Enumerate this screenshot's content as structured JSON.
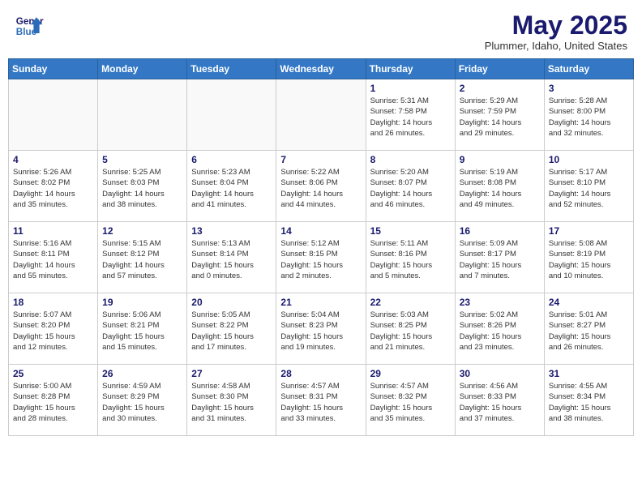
{
  "header": {
    "logo_line1": "General",
    "logo_line2": "Blue",
    "month": "May 2025",
    "location": "Plummer, Idaho, United States"
  },
  "weekdays": [
    "Sunday",
    "Monday",
    "Tuesday",
    "Wednesday",
    "Thursday",
    "Friday",
    "Saturday"
  ],
  "weeks": [
    [
      {
        "day": "",
        "detail": ""
      },
      {
        "day": "",
        "detail": ""
      },
      {
        "day": "",
        "detail": ""
      },
      {
        "day": "",
        "detail": ""
      },
      {
        "day": "1",
        "detail": "Sunrise: 5:31 AM\nSunset: 7:58 PM\nDaylight: 14 hours\nand 26 minutes."
      },
      {
        "day": "2",
        "detail": "Sunrise: 5:29 AM\nSunset: 7:59 PM\nDaylight: 14 hours\nand 29 minutes."
      },
      {
        "day": "3",
        "detail": "Sunrise: 5:28 AM\nSunset: 8:00 PM\nDaylight: 14 hours\nand 32 minutes."
      }
    ],
    [
      {
        "day": "4",
        "detail": "Sunrise: 5:26 AM\nSunset: 8:02 PM\nDaylight: 14 hours\nand 35 minutes."
      },
      {
        "day": "5",
        "detail": "Sunrise: 5:25 AM\nSunset: 8:03 PM\nDaylight: 14 hours\nand 38 minutes."
      },
      {
        "day": "6",
        "detail": "Sunrise: 5:23 AM\nSunset: 8:04 PM\nDaylight: 14 hours\nand 41 minutes."
      },
      {
        "day": "7",
        "detail": "Sunrise: 5:22 AM\nSunset: 8:06 PM\nDaylight: 14 hours\nand 44 minutes."
      },
      {
        "day": "8",
        "detail": "Sunrise: 5:20 AM\nSunset: 8:07 PM\nDaylight: 14 hours\nand 46 minutes."
      },
      {
        "day": "9",
        "detail": "Sunrise: 5:19 AM\nSunset: 8:08 PM\nDaylight: 14 hours\nand 49 minutes."
      },
      {
        "day": "10",
        "detail": "Sunrise: 5:17 AM\nSunset: 8:10 PM\nDaylight: 14 hours\nand 52 minutes."
      }
    ],
    [
      {
        "day": "11",
        "detail": "Sunrise: 5:16 AM\nSunset: 8:11 PM\nDaylight: 14 hours\nand 55 minutes."
      },
      {
        "day": "12",
        "detail": "Sunrise: 5:15 AM\nSunset: 8:12 PM\nDaylight: 14 hours\nand 57 minutes."
      },
      {
        "day": "13",
        "detail": "Sunrise: 5:13 AM\nSunset: 8:14 PM\nDaylight: 15 hours\nand 0 minutes."
      },
      {
        "day": "14",
        "detail": "Sunrise: 5:12 AM\nSunset: 8:15 PM\nDaylight: 15 hours\nand 2 minutes."
      },
      {
        "day": "15",
        "detail": "Sunrise: 5:11 AM\nSunset: 8:16 PM\nDaylight: 15 hours\nand 5 minutes."
      },
      {
        "day": "16",
        "detail": "Sunrise: 5:09 AM\nSunset: 8:17 PM\nDaylight: 15 hours\nand 7 minutes."
      },
      {
        "day": "17",
        "detail": "Sunrise: 5:08 AM\nSunset: 8:19 PM\nDaylight: 15 hours\nand 10 minutes."
      }
    ],
    [
      {
        "day": "18",
        "detail": "Sunrise: 5:07 AM\nSunset: 8:20 PM\nDaylight: 15 hours\nand 12 minutes."
      },
      {
        "day": "19",
        "detail": "Sunrise: 5:06 AM\nSunset: 8:21 PM\nDaylight: 15 hours\nand 15 minutes."
      },
      {
        "day": "20",
        "detail": "Sunrise: 5:05 AM\nSunset: 8:22 PM\nDaylight: 15 hours\nand 17 minutes."
      },
      {
        "day": "21",
        "detail": "Sunrise: 5:04 AM\nSunset: 8:23 PM\nDaylight: 15 hours\nand 19 minutes."
      },
      {
        "day": "22",
        "detail": "Sunrise: 5:03 AM\nSunset: 8:25 PM\nDaylight: 15 hours\nand 21 minutes."
      },
      {
        "day": "23",
        "detail": "Sunrise: 5:02 AM\nSunset: 8:26 PM\nDaylight: 15 hours\nand 23 minutes."
      },
      {
        "day": "24",
        "detail": "Sunrise: 5:01 AM\nSunset: 8:27 PM\nDaylight: 15 hours\nand 26 minutes."
      }
    ],
    [
      {
        "day": "25",
        "detail": "Sunrise: 5:00 AM\nSunset: 8:28 PM\nDaylight: 15 hours\nand 28 minutes."
      },
      {
        "day": "26",
        "detail": "Sunrise: 4:59 AM\nSunset: 8:29 PM\nDaylight: 15 hours\nand 30 minutes."
      },
      {
        "day": "27",
        "detail": "Sunrise: 4:58 AM\nSunset: 8:30 PM\nDaylight: 15 hours\nand 31 minutes."
      },
      {
        "day": "28",
        "detail": "Sunrise: 4:57 AM\nSunset: 8:31 PM\nDaylight: 15 hours\nand 33 minutes."
      },
      {
        "day": "29",
        "detail": "Sunrise: 4:57 AM\nSunset: 8:32 PM\nDaylight: 15 hours\nand 35 minutes."
      },
      {
        "day": "30",
        "detail": "Sunrise: 4:56 AM\nSunset: 8:33 PM\nDaylight: 15 hours\nand 37 minutes."
      },
      {
        "day": "31",
        "detail": "Sunrise: 4:55 AM\nSunset: 8:34 PM\nDaylight: 15 hours\nand 38 minutes."
      }
    ]
  ]
}
